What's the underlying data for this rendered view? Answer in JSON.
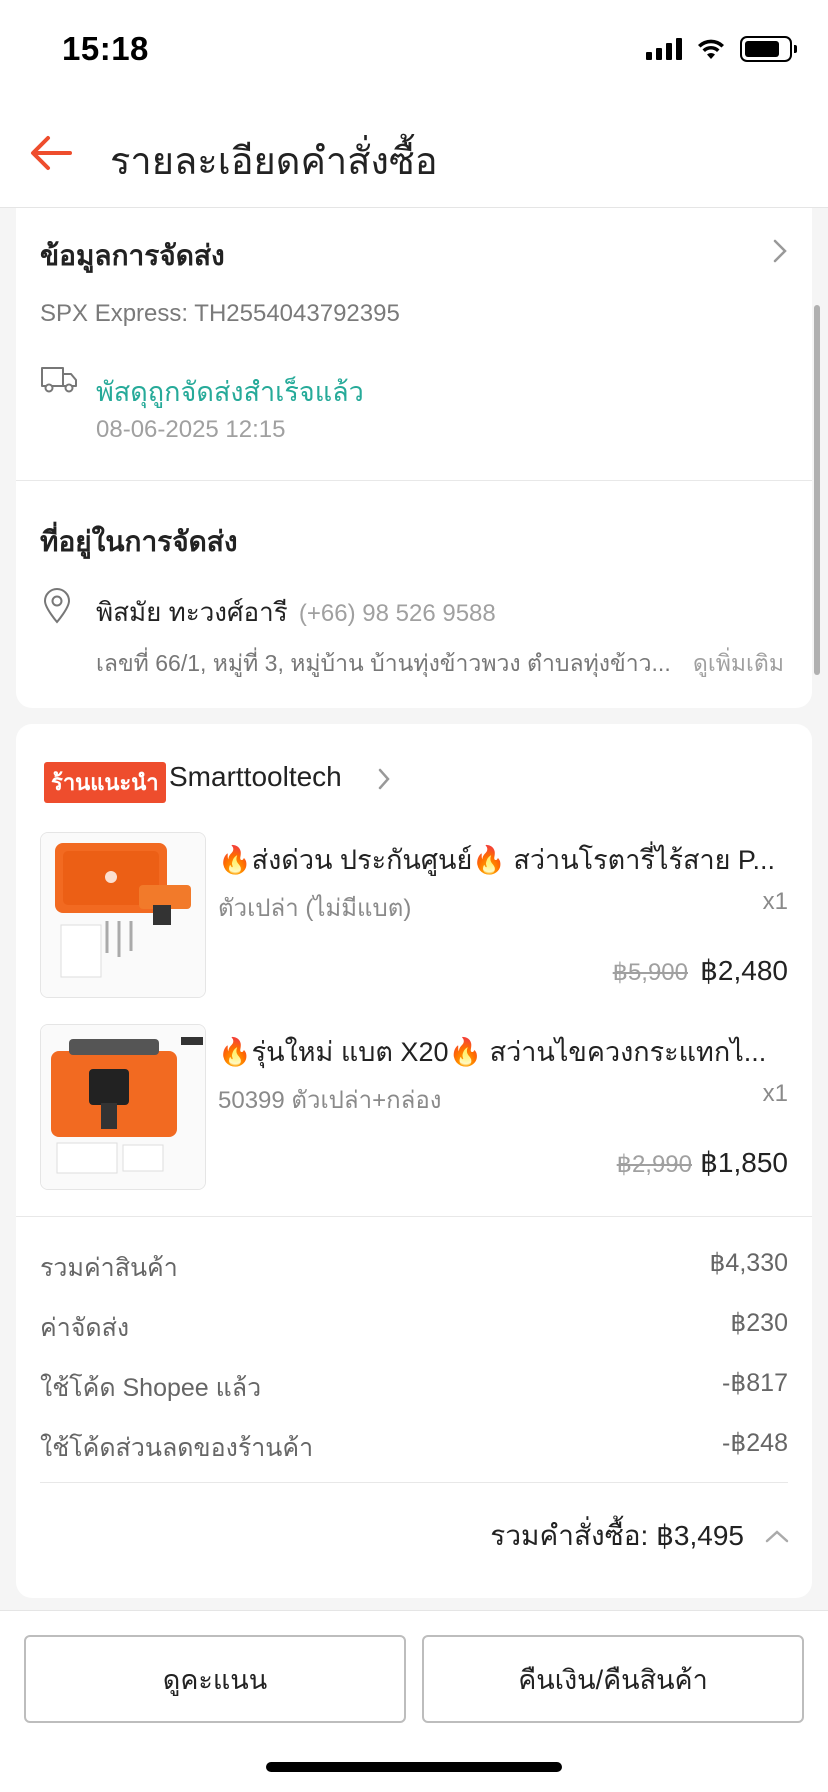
{
  "status_bar": {
    "time": "15:18"
  },
  "header": {
    "title": "รายละเอียดคำสั่งซื้อ"
  },
  "shipping_info": {
    "title": "ข้อมูลการจัดส่ง",
    "tracking": "SPX Express: TH2554043792395",
    "status": "พัสดุถูกจัดส่งสำเร็จแล้ว",
    "status_time": "08-06-2025 12:15",
    "status_color": "#26aa99"
  },
  "address": {
    "title": "ที่อยู่ในการจัดส่ง",
    "name": "พิสมัย ทะวงศ์อารี",
    "phone": "(+66) 98 526 9588",
    "line": "เลขที่ 66/1, หมู่ที่ 3, หมู่บ้าน บ้านทุ่งข้าวพวง ตำบลทุ่งข้าว...",
    "more_label": "ดูเพิ่มเติม"
  },
  "shop": {
    "badge": "ร้านแนะนำ",
    "name": "Smarttooltech"
  },
  "products": [
    {
      "title": "🔥ส่งด่วน ประกันศูนย์🔥 สว่านโรตารี่ไร้สาย P...",
      "variant": "ตัวเปล่า (ไม่มีแบต)",
      "qty": "x1",
      "price_old": "฿5,900",
      "price_new": "฿2,480"
    },
    {
      "title": "🔥รุ่นใหม่ แบต X20🔥 สว่านไขควงกระแทกไ...",
      "variant": "50399 ตัวเปล่า+กล่อง",
      "qty": "x1",
      "price_old": "฿2,990",
      "price_new": "฿1,850"
    }
  ],
  "summary": {
    "rows": [
      {
        "label": "รวมค่าสินค้า",
        "value": "฿4,330"
      },
      {
        "label": "ค่าจัดส่ง",
        "value": "฿230"
      },
      {
        "label": "ใช้โค้ด Shopee แล้ว",
        "value": "-฿817"
      },
      {
        "label": "ใช้โค้ดส่วนลดของร้านค้า",
        "value": "-฿248"
      }
    ],
    "total_label": "รวมคำสั่งซื้อ: ฿3,495"
  },
  "actions": {
    "rate_label": "ดูคะแนน",
    "refund_label": "คืนเงิน/คืนสินค้า"
  },
  "colors": {
    "accent": "#ee4d2d",
    "success": "#26aa99"
  }
}
